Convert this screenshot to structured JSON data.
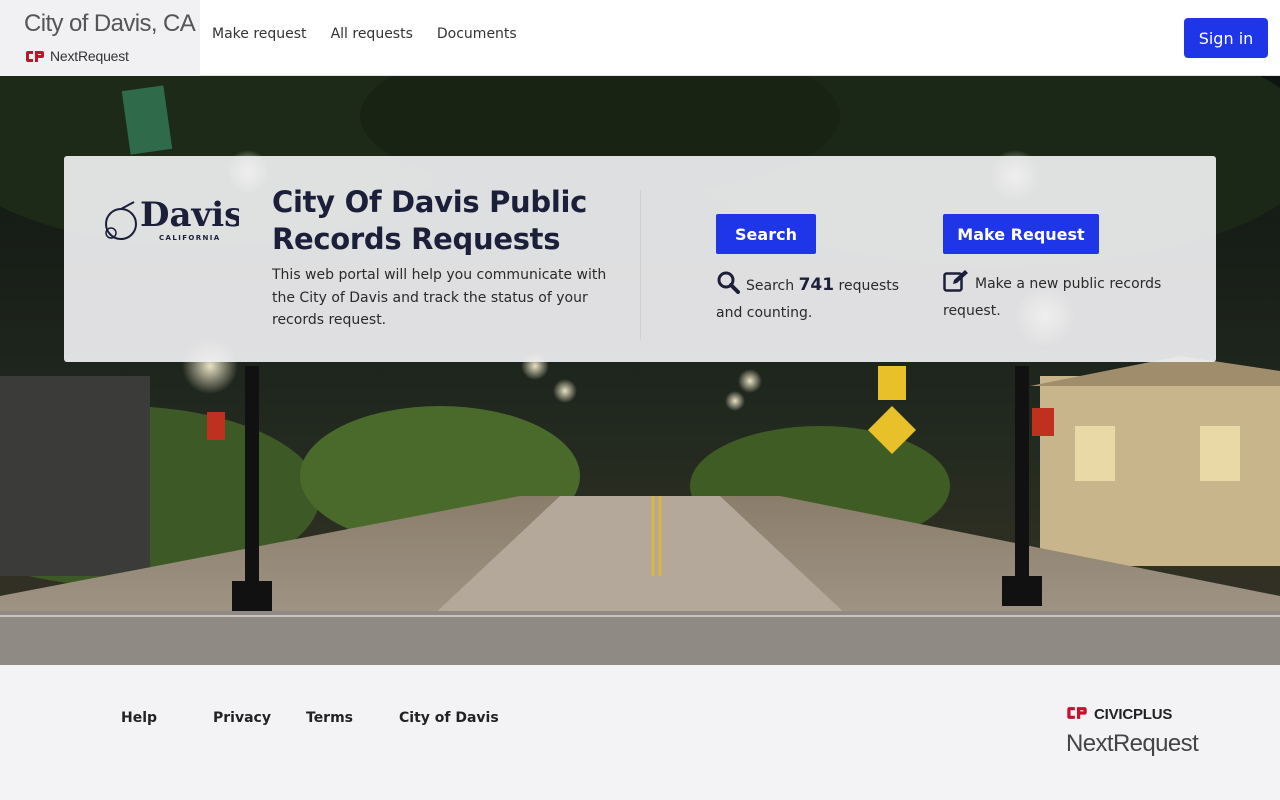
{
  "header": {
    "site_title": "City of Davis, CA",
    "product_name": "NextRequest",
    "nav": [
      "Make request",
      "All requests",
      "Documents"
    ],
    "sign_in": "Sign in"
  },
  "hero": {
    "logo_text": "Davis",
    "logo_subtext": "CALIFORNIA",
    "title": "City Of Davis Public Records Requests",
    "description": "This web portal will help you communicate with the City of Davis and track the status of your records request.",
    "search_button": "Search",
    "search_prefix": "Search",
    "request_count": "741",
    "search_suffix": "requests and counting.",
    "make_request_button": "Make Request",
    "make_request_desc": "Make a new public records request."
  },
  "footer": {
    "links": [
      "Help",
      "Privacy",
      "Terms",
      "City of Davis"
    ],
    "brand_civic": "CIVICPLUS",
    "brand_next": "NextRequest"
  },
  "colors": {
    "primary": "#1f35e8",
    "brand_red": "#c8102e",
    "title_navy": "#1c1f3a"
  }
}
